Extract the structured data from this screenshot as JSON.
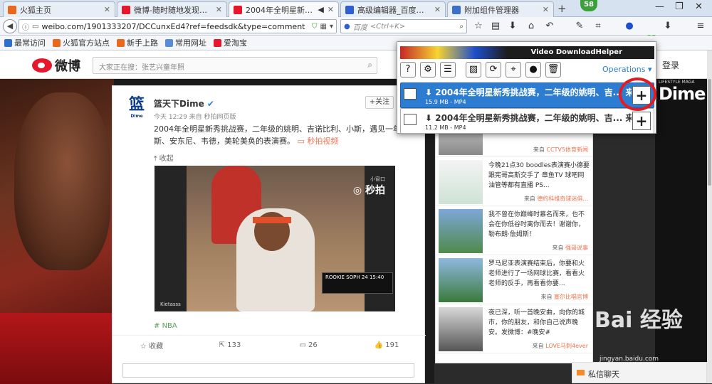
{
  "tabs": [
    {
      "label": "火狐主页",
      "color": "#e8681e"
    },
    {
      "label": "微博-随时随地发现新鲜事",
      "color": "#e6162d"
    },
    {
      "label": "2004年全明星新秀挑...",
      "color": "#e6162d"
    },
    {
      "label": "高级编辑器_百度经验",
      "color": "#2f5fd0"
    },
    {
      "label": "附加组件管理器",
      "color": "#3b6fc8"
    }
  ],
  "new_tab": "+",
  "update_badge": "58",
  "window_controls": [
    "—",
    "❐",
    "✕"
  ],
  "url": "weibo.com/1901333207/DCCunxEd4?ref=feedsdk&type=comment",
  "search_engine": "百度",
  "search_placeholder": "<Ctrl+K>",
  "extension_badge": "2",
  "bookmarks": [
    {
      "label": "最常访问",
      "color": "#2f6fd0"
    },
    {
      "label": "火狐官方站点",
      "color": "#e8681e"
    },
    {
      "label": "新手上路",
      "color": "#e8681e"
    },
    {
      "label": "常用网址",
      "color": "#5a8bd6"
    },
    {
      "label": "爱淘宝",
      "color": "#e6162d"
    }
  ],
  "weibo": {
    "logo": "微博",
    "search_placeholder": "大家正在搜：张艺兴童年照",
    "login": "登录"
  },
  "post": {
    "avatar_text": "篮",
    "avatar_sub": "Dime",
    "author": "篮天下Dime",
    "time": "今天 12:29 来自 秒拍网页版",
    "follow": "+关注",
    "text": "2004年全明星新秀挑战赛，二年级的姚明、吉诺比利、小斯，遇见一年级的",
    "text2": "斯、安东尼、韦德，美轮美奂的表演赛。",
    "video_link": "秒拍视频",
    "fold": "收起",
    "video_watermark": "秒拍",
    "video_watermark_sub": "小窗口",
    "video_corner": "Kietasss",
    "score_text": "ROOKIE  SOPH  24 15:40",
    "tag": "NBA",
    "actions": [
      {
        "label": "收藏"
      },
      {
        "label": "133"
      },
      {
        "label": "26"
      },
      {
        "label": "191"
      }
    ]
  },
  "feed": [
    {
      "text": "",
      "source_prefix": "来自",
      "source": "CCTV5体育新闻"
    },
    {
      "text": "今晚21点30 boodles表演赛小德要跟宪哥高斯交手了 章鱼TV 球吧网 油管等都有直播 PS...",
      "source_prefix": "来自",
      "source": "德约科维奇球迷俱..."
    },
    {
      "text": "我不曾在你巅峰时慕名而来，也不会在你低谷时离你而去！谢谢你，勒布朗·詹姆斯！",
      "source_prefix": "来自",
      "source": "强哥说事"
    },
    {
      "text": "罗马尼亚表演赛结束后，你要和火老师进行了一场网球比赛，看看火老师的反手，再看看你要...",
      "source_prefix": "来自",
      "source": "塞尔比唱官博"
    },
    {
      "text": "夜已深，听一首晚安曲，向你的城市，你的朋友，和你自己说声晚安。发微博：#晚安#",
      "source_prefix": "来自",
      "source": "LOVE马刺4ever"
    }
  ],
  "chat": "私信聊天",
  "watermark": "Bai 经验",
  "watermark_url": "jingyan.baidu.com",
  "bg_text": {
    "dime": "Dime",
    "lifestyle": "LIFESTYLE MAGA"
  },
  "downloadhelper": {
    "title": "Video DownloadHelper",
    "operations": "Operations ▾",
    "items": [
      {
        "title": "2004年全明星新秀挑战赛，二年级的姚明、吉... 来...",
        "meta": "15.9 MB - MP4",
        "selected": true
      },
      {
        "title": "2004年全明星新秀挑战赛，二年级的姚明、吉... 来...",
        "meta": "11.2 MB - MP4",
        "selected": false
      }
    ]
  }
}
